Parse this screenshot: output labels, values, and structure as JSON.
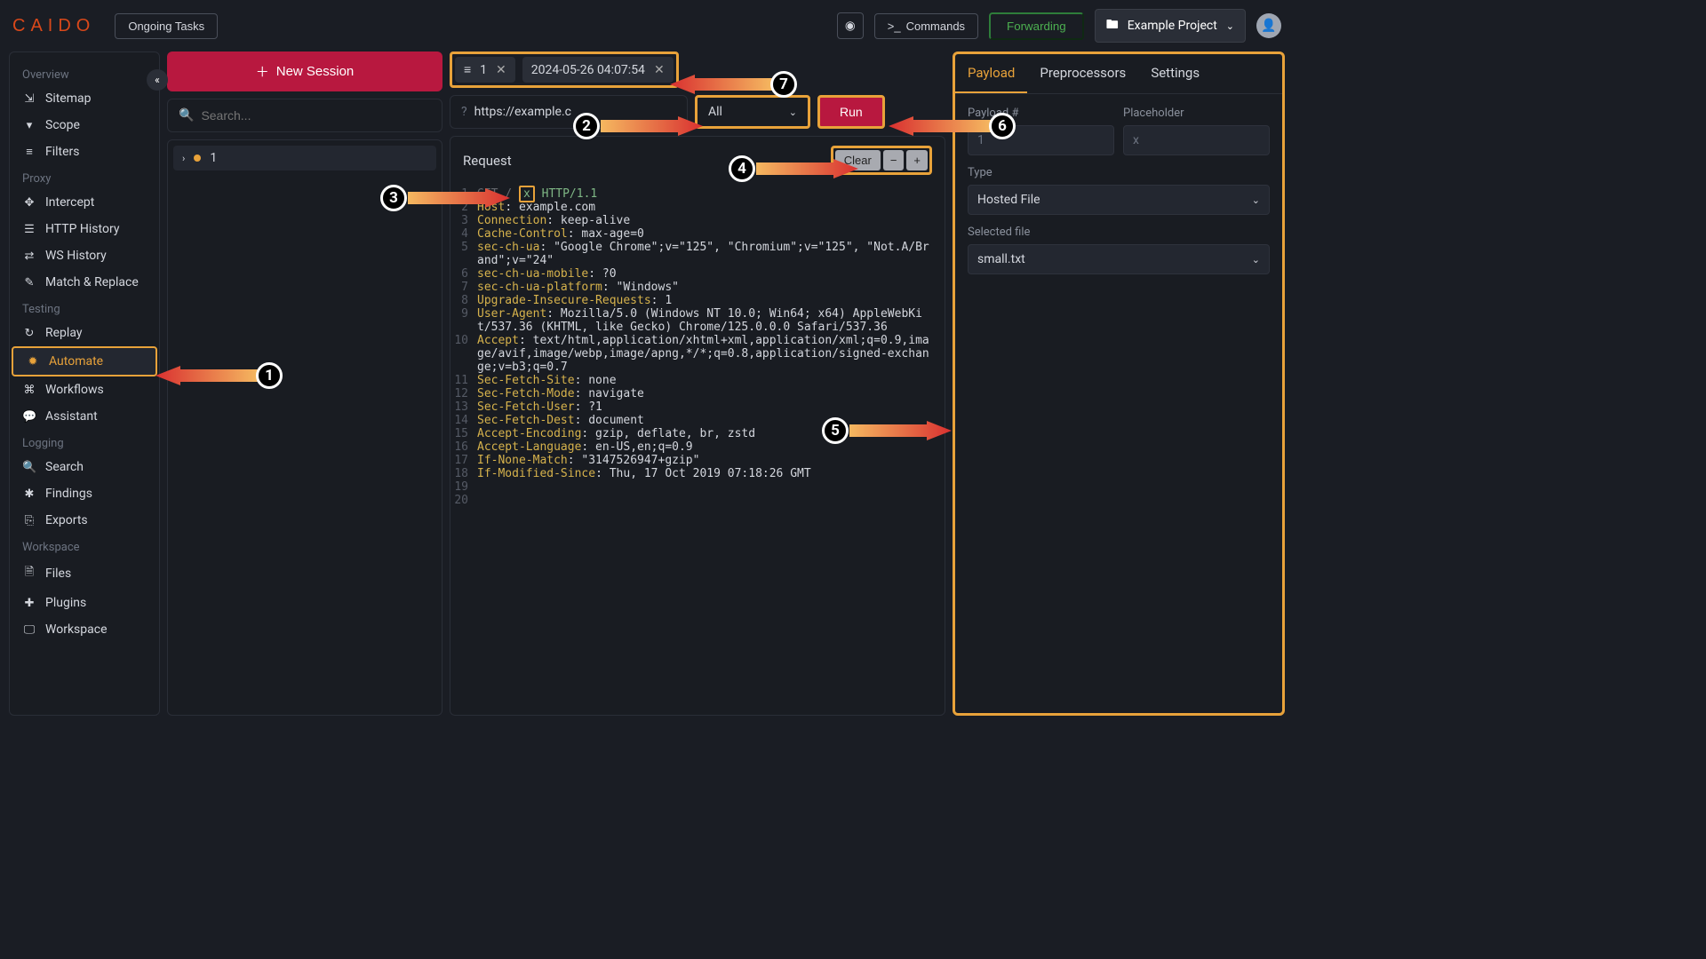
{
  "brand": "CAIDO",
  "topbar": {
    "ongoing": "Ongoing Tasks",
    "commands": "Commands",
    "forwarding": "Forwarding",
    "project": "Example Project"
  },
  "sidebar": {
    "sections": {
      "overview": "Overview",
      "proxy": "Proxy",
      "testing": "Testing",
      "logging": "Logging",
      "workspace": "Workspace"
    },
    "items": {
      "sitemap": "Sitemap",
      "scope": "Scope",
      "filters": "Filters",
      "intercept": "Intercept",
      "http_history": "HTTP History",
      "ws_history": "WS History",
      "match_replace": "Match & Replace",
      "replay": "Replay",
      "automate": "Automate",
      "workflows": "Workflows",
      "assistant": "Assistant",
      "search": "Search",
      "findings": "Findings",
      "exports": "Exports",
      "files": "Files",
      "plugins": "Plugins",
      "workspace": "Workspace"
    }
  },
  "sessions": {
    "new": "New Session",
    "search_placeholder": "Search...",
    "list": [
      {
        "id": "1"
      }
    ]
  },
  "tabs": {
    "filter_count": "1",
    "timestamp": "2024-05-26 04:07:54"
  },
  "url": "https://example.c",
  "strategy": "All",
  "run": "Run",
  "request": {
    "title": "Request",
    "clear": "Clear",
    "marker": "x",
    "lines": [
      {
        "n": 1,
        "pre": "GET / ",
        "marker": true,
        "post": " HTTP/1.1"
      },
      {
        "n": 2,
        "k": "Host",
        "v": "example.com"
      },
      {
        "n": 3,
        "k": "Connection",
        "v": "keep-alive"
      },
      {
        "n": 4,
        "k": "Cache-Control",
        "v": "max-age=0"
      },
      {
        "n": 5,
        "k": "sec-ch-ua",
        "v": "\"Google Chrome\";v=\"125\", \"Chromium\";v=\"125\", \"Not.A/Brand\";v=\"24\""
      },
      {
        "n": 6,
        "k": "sec-ch-ua-mobile",
        "v": "?0"
      },
      {
        "n": 7,
        "k": "sec-ch-ua-platform",
        "v": "\"Windows\""
      },
      {
        "n": 8,
        "k": "Upgrade-Insecure-Requests",
        "v": "1"
      },
      {
        "n": 9,
        "k": "User-Agent",
        "v": "Mozilla/5.0 (Windows NT 10.0; Win64; x64) AppleWebKit/537.36 (KHTML, like Gecko) Chrome/125.0.0.0 Safari/537.36"
      },
      {
        "n": 10,
        "k": "Accept",
        "v": "text/html,application/xhtml+xml,application/xml;q=0.9,image/avif,image/webp,image/apng,*/*;q=0.8,application/signed-exchange;v=b3;q=0.7"
      },
      {
        "n": 11,
        "k": "Sec-Fetch-Site",
        "v": "none"
      },
      {
        "n": 12,
        "k": "Sec-Fetch-Mode",
        "v": "navigate"
      },
      {
        "n": 13,
        "k": "Sec-Fetch-User",
        "v": "?1"
      },
      {
        "n": 14,
        "k": "Sec-Fetch-Dest",
        "v": "document"
      },
      {
        "n": 15,
        "k": "Accept-Encoding",
        "v": "gzip, deflate, br, zstd"
      },
      {
        "n": 16,
        "k": "Accept-Language",
        "v": "en-US,en;q=0.9"
      },
      {
        "n": 17,
        "k": "If-None-Match",
        "v": "\"3147526947+gzip\""
      },
      {
        "n": 18,
        "k": "If-Modified-Since",
        "v": "Thu, 17 Oct 2019 07:18:26 GMT"
      },
      {
        "n": 19,
        "blank": true
      },
      {
        "n": 20,
        "blank": true
      }
    ]
  },
  "rightpanel": {
    "tabs": {
      "payload": "Payload",
      "pre": "Preprocessors",
      "settings": "Settings"
    },
    "payload_num_label": "Payload #",
    "payload_num": "1",
    "placeholder_label": "Placeholder",
    "placeholder_val": "x",
    "type_label": "Type",
    "type_val": "Hosted File",
    "file_label": "Selected file",
    "file_val": "small.txt"
  },
  "annotations": [
    "1",
    "2",
    "3",
    "4",
    "5",
    "6",
    "7"
  ]
}
